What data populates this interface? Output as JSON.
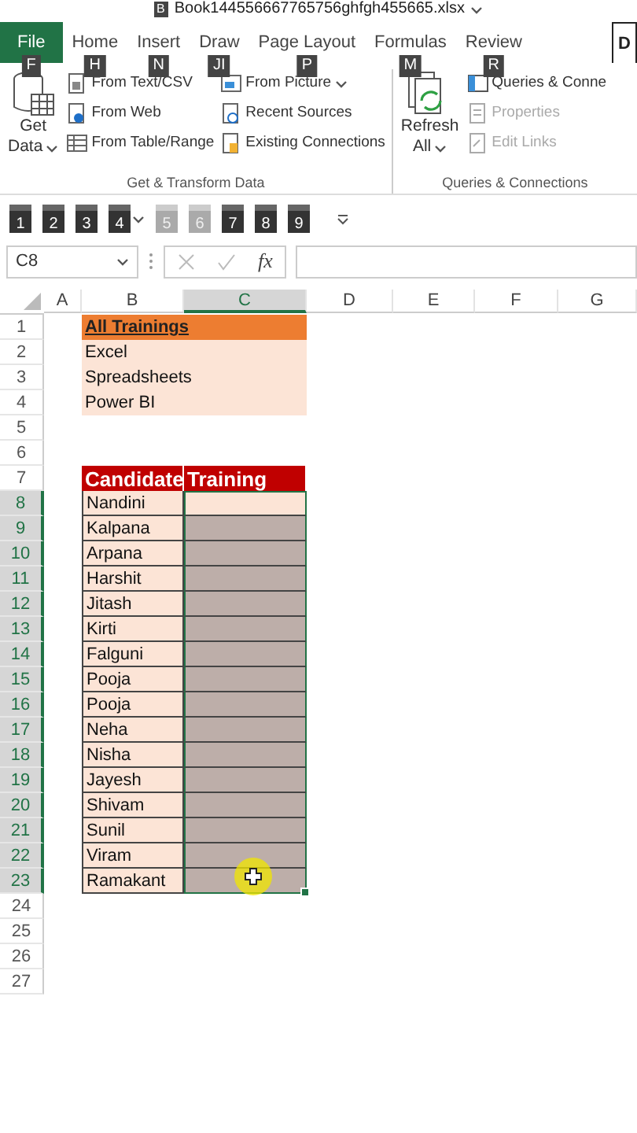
{
  "window": {
    "title": "Book144556667765756ghfgh455665.xlsx",
    "keytip": "B"
  },
  "tabs": [
    {
      "label": "File",
      "kind": "file",
      "selected": false,
      "keytip": "F"
    },
    {
      "label": "Home",
      "kind": "tab",
      "selected": false,
      "keytip": "H"
    },
    {
      "label": "Insert",
      "kind": "tab",
      "selected": false,
      "keytip": "N"
    },
    {
      "label": "Draw",
      "kind": "tab",
      "selected": false,
      "keytip": "JI"
    },
    {
      "label": "Page Layout",
      "kind": "tab",
      "selected": false,
      "keytip": "P"
    },
    {
      "label": "Formulas",
      "kind": "tab",
      "selected": false,
      "keytip": "M"
    },
    {
      "label": "Review",
      "kind": "tab",
      "selected": false,
      "keytip": "R"
    },
    {
      "label": "D",
      "kind": "tab",
      "selected": true
    }
  ],
  "ribbon": {
    "groups": [
      {
        "label": "Get & Transform Data",
        "big": {
          "lines": [
            "Get",
            "Data"
          ],
          "dropdown": true
        },
        "columns": [
          [
            {
              "label": "From Text/CSV",
              "disabled": false,
              "dropdown": false
            },
            {
              "label": "From Web",
              "disabled": false,
              "dropdown": false
            },
            {
              "label": "From Table/Range",
              "disabled": false,
              "dropdown": false
            }
          ],
          [
            {
              "label": "From Picture",
              "disabled": false,
              "dropdown": true
            },
            {
              "label": "Recent Sources",
              "disabled": false,
              "dropdown": false
            },
            {
              "label": "Existing Connections",
              "disabled": false,
              "dropdown": false
            }
          ]
        ]
      },
      {
        "label": "Queries & Connections",
        "big": {
          "lines": [
            "Refresh",
            "All"
          ],
          "dropdown": true
        },
        "columns": [
          [
            {
              "label": "Queries & Conne",
              "disabled": false,
              "dropdown": false
            },
            {
              "label": "Properties",
              "disabled": true,
              "dropdown": false
            },
            {
              "label": "Edit Links",
              "disabled": true,
              "dropdown": false
            }
          ]
        ]
      }
    ]
  },
  "quick_access": [
    {
      "label": "1",
      "disabled": false,
      "dropdown": false
    },
    {
      "label": "2",
      "disabled": false,
      "dropdown": false
    },
    {
      "label": "3",
      "disabled": false,
      "dropdown": false
    },
    {
      "label": "4",
      "disabled": false,
      "dropdown": true
    },
    {
      "label": "5",
      "disabled": true,
      "dropdown": false
    },
    {
      "label": "6",
      "disabled": true,
      "dropdown": false
    },
    {
      "label": "7",
      "disabled": false,
      "dropdown": false
    },
    {
      "label": "8",
      "disabled": false,
      "dropdown": false
    },
    {
      "label": "9",
      "disabled": false,
      "dropdown": false
    }
  ],
  "formula_bar": {
    "name_box": "C8",
    "function_label": "fx"
  },
  "columns": [
    {
      "label": "A",
      "selected": false
    },
    {
      "label": "B",
      "selected": false
    },
    {
      "label": "C",
      "selected": true
    },
    {
      "label": "D",
      "selected": false
    },
    {
      "label": "E",
      "selected": false
    },
    {
      "label": "F",
      "selected": false
    },
    {
      "label": "G",
      "selected": false
    }
  ],
  "rows": [
    {
      "n": "1",
      "selected": false,
      "kind": "title",
      "b": "All Trainings"
    },
    {
      "n": "2",
      "selected": false,
      "kind": "list",
      "b": "Excel"
    },
    {
      "n": "3",
      "selected": false,
      "kind": "list",
      "b": "Spreadsheets"
    },
    {
      "n": "4",
      "selected": false,
      "kind": "list",
      "b": "Power BI"
    },
    {
      "n": "5",
      "selected": false
    },
    {
      "n": "6",
      "selected": false
    },
    {
      "n": "7",
      "selected": false,
      "kind": "header",
      "b": "Candidate",
      "c": "Training"
    },
    {
      "n": "8",
      "selected": true,
      "active": true,
      "kind": "entry",
      "b": "Nandini"
    },
    {
      "n": "9",
      "selected": true,
      "active": false,
      "kind": "entry",
      "b": "Kalpana"
    },
    {
      "n": "10",
      "selected": true,
      "active": false,
      "kind": "entry",
      "b": "Arpana"
    },
    {
      "n": "11",
      "selected": true,
      "active": false,
      "kind": "entry",
      "b": "Harshit"
    },
    {
      "n": "12",
      "selected": true,
      "active": false,
      "kind": "entry",
      "b": "Jitash"
    },
    {
      "n": "13",
      "selected": true,
      "active": false,
      "kind": "entry",
      "b": "Kirti"
    },
    {
      "n": "14",
      "selected": true,
      "active": false,
      "kind": "entry",
      "b": "Falguni"
    },
    {
      "n": "15",
      "selected": true,
      "active": false,
      "kind": "entry",
      "b": "Pooja"
    },
    {
      "n": "16",
      "selected": true,
      "active": false,
      "kind": "entry",
      "b": "Pooja"
    },
    {
      "n": "17",
      "selected": true,
      "active": false,
      "kind": "entry",
      "b": "Neha"
    },
    {
      "n": "18",
      "selected": true,
      "active": false,
      "kind": "entry",
      "b": "Nisha"
    },
    {
      "n": "19",
      "selected": true,
      "active": false,
      "kind": "entry",
      "b": "Jayesh"
    },
    {
      "n": "20",
      "selected": true,
      "active": false,
      "kind": "entry",
      "b": "Shivam"
    },
    {
      "n": "21",
      "selected": true,
      "active": false,
      "kind": "entry",
      "b": "Sunil"
    },
    {
      "n": "22",
      "selected": true,
      "active": false,
      "kind": "entry",
      "b": "Viram"
    },
    {
      "n": "23",
      "selected": true,
      "active": false,
      "kind": "entry",
      "b": "Ramakant"
    },
    {
      "n": "24",
      "selected": false
    },
    {
      "n": "25",
      "selected": false
    },
    {
      "n": "26",
      "selected": false
    },
    {
      "n": "27",
      "selected": false
    }
  ]
}
